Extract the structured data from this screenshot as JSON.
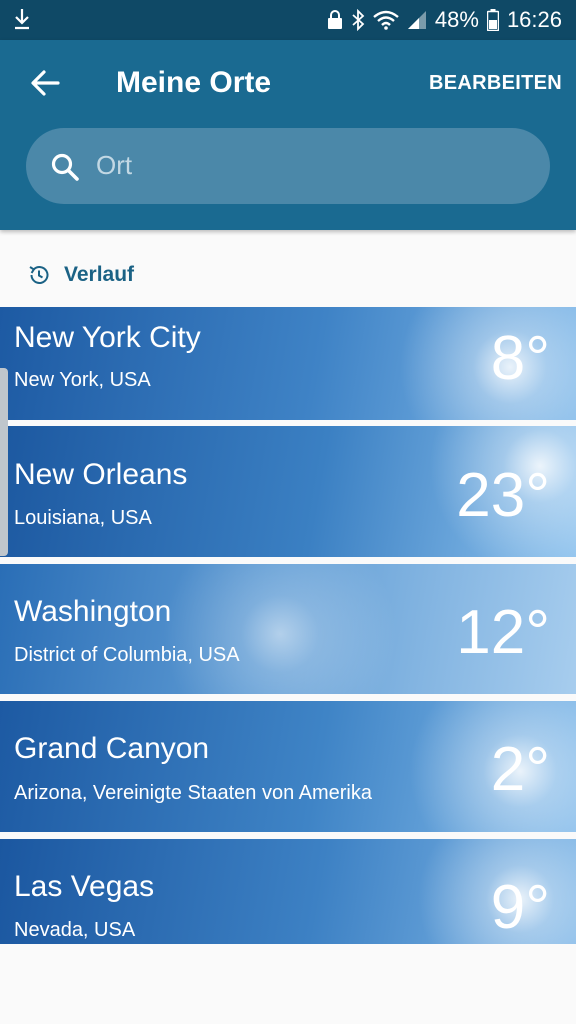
{
  "status_bar": {
    "battery": "48%",
    "time": "16:26",
    "icons": [
      "download-icon",
      "lock-icon",
      "bluetooth-icon",
      "wifi-icon",
      "signal-icon",
      "battery-icon"
    ]
  },
  "app_bar": {
    "title": "Meine Orte",
    "edit_label": "BEARBEITEN"
  },
  "search": {
    "placeholder": "Ort"
  },
  "history": {
    "label": "Verlauf"
  },
  "locations": [
    {
      "city": "New York City",
      "region": "New York, USA",
      "temp": "8°"
    },
    {
      "city": "New Orleans",
      "region": "Louisiana, USA",
      "temp": "23°"
    },
    {
      "city": "Washington",
      "region": "District of Columbia, USA",
      "temp": "12°"
    },
    {
      "city": "Grand Canyon",
      "region": "Arizona, Vereinigte Staaten von Amerika",
      "temp": "2°"
    },
    {
      "city": "Las Vegas",
      "region": "Nevada, USA",
      "temp": "9°"
    }
  ],
  "colors": {
    "status_bar": "#0f4966",
    "app_bar": "#1a6a91",
    "search_field": "#4b88a9",
    "history_text": "#1b6285",
    "sky_dark": "#1f5fa6",
    "sky_light": "#8ec2ec"
  }
}
